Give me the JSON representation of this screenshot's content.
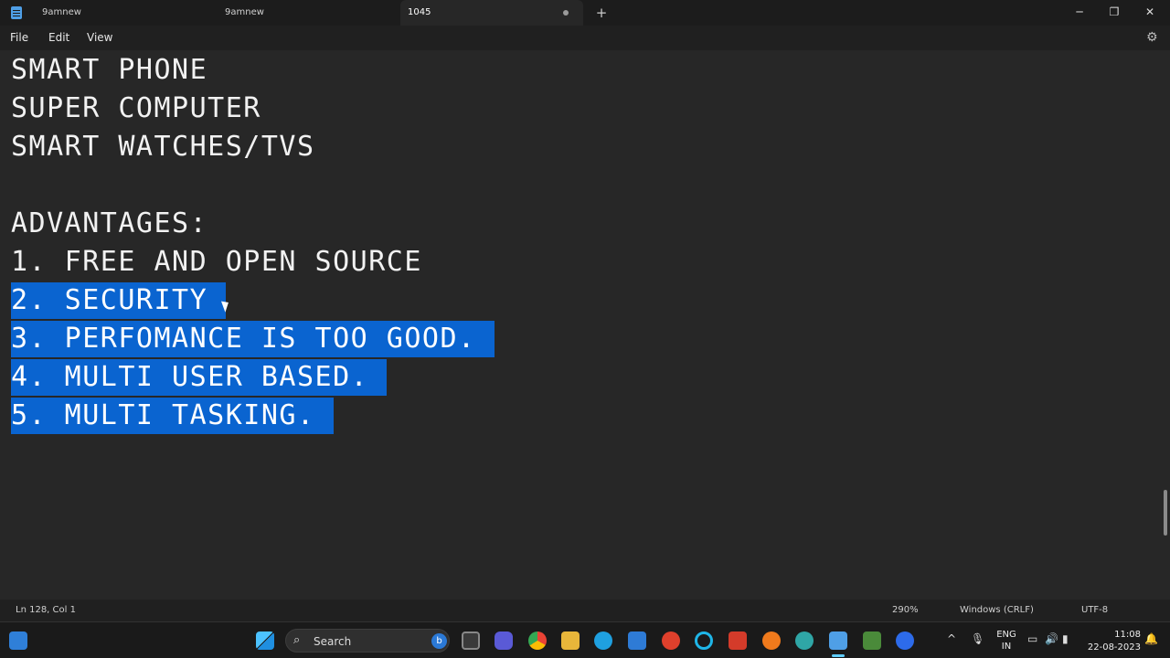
{
  "tabs": [
    {
      "label": "9amnew"
    },
    {
      "label": "9amnew"
    },
    {
      "label": "1045"
    }
  ],
  "window": {
    "minimize": "─",
    "maximize": "❐",
    "close": "✕",
    "new_tab": "+"
  },
  "menu": {
    "file": "File",
    "edit": "Edit",
    "view": "View"
  },
  "editor": {
    "lines": [
      "SMART PHONE",
      "SUPER COMPUTER",
      "SMART WATCHES/TVS",
      "",
      "ADVANTAGES:",
      "1. FREE AND OPEN SOURCE",
      "2. SECURITY",
      "3. PERFOMANCE IS TOO GOOD.",
      "4. MULTI USER BASED.",
      "5. MULTI TASKING."
    ],
    "selected_lines": [
      6,
      7,
      8,
      9
    ]
  },
  "status": {
    "position": "Ln 128, Col 1",
    "zoom": "290%",
    "line_ending": "Windows (CRLF)",
    "encoding": "UTF-8"
  },
  "taskbar": {
    "search_label": "Search",
    "language": "ENG",
    "region": "IN",
    "time": "11:08",
    "date": "22-08-2023"
  },
  "colors": {
    "selection": "#0a64d0",
    "editor_bg": "#272727",
    "accent": "#60cdff"
  }
}
